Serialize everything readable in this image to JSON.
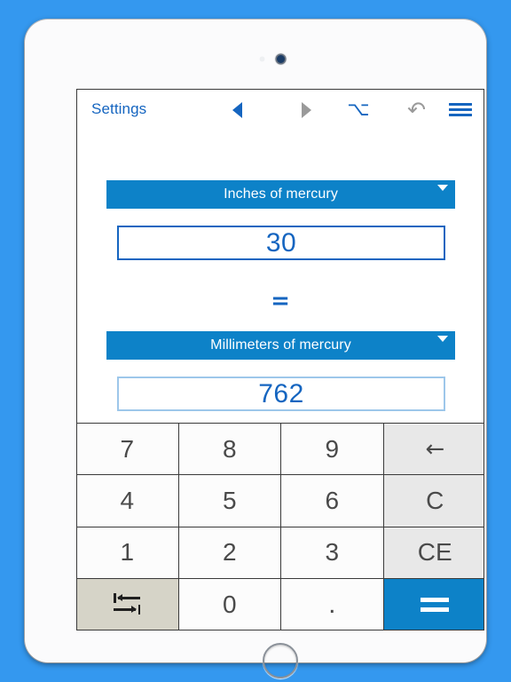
{
  "device": {
    "camera_icon": "camera-lens",
    "sensor_icon": "ambient-light-sensor",
    "home_button_label": "Home"
  },
  "toolbar": {
    "settings_label": "Settings",
    "back_icon": "triangle-left-icon",
    "forward_icon": "triangle-right-icon",
    "option_icon": "option-key-icon",
    "option_glyph": "⌥",
    "undo_icon": "undo-arrow-icon",
    "undo_glyph": "↷",
    "menu_icon": "hamburger-menu-icon",
    "back_color": "#1565c0",
    "forward_color": "#9a9a9a",
    "undo_color": "#9a9a9a",
    "menu_color": "#1565c0"
  },
  "converter": {
    "accent_color": "#0d82c8",
    "text_color": "#1565c0",
    "source": {
      "unit_label": "Inches of mercury",
      "value": "30",
      "caret_icon": "chevron-down-icon",
      "focused": true
    },
    "equals_separator": "=",
    "target": {
      "unit_label": "Millimeters of mercury",
      "value": "762",
      "caret_icon": "chevron-down-icon",
      "focused": false
    }
  },
  "keypad": {
    "keys": [
      {
        "label": "7",
        "name": "key-7",
        "type": "digit"
      },
      {
        "label": "8",
        "name": "key-8",
        "type": "digit"
      },
      {
        "label": "9",
        "name": "key-9",
        "type": "digit"
      },
      {
        "label": "←",
        "name": "key-backspace",
        "type": "func"
      },
      {
        "label": "4",
        "name": "key-4",
        "type": "digit"
      },
      {
        "label": "5",
        "name": "key-5",
        "type": "digit"
      },
      {
        "label": "6",
        "name": "key-6",
        "type": "digit"
      },
      {
        "label": "C",
        "name": "key-clear",
        "type": "func"
      },
      {
        "label": "1",
        "name": "key-1",
        "type": "digit"
      },
      {
        "label": "2",
        "name": "key-2",
        "type": "digit"
      },
      {
        "label": "3",
        "name": "key-3",
        "type": "digit"
      },
      {
        "label": "CE",
        "name": "key-clear-entry",
        "type": "func"
      },
      {
        "label": "",
        "name": "key-swap-units",
        "type": "swap"
      },
      {
        "label": "0",
        "name": "key-0",
        "type": "digit"
      },
      {
        "label": ".",
        "name": "key-decimal",
        "type": "dot"
      },
      {
        "label": "=",
        "name": "key-equals",
        "type": "eq"
      }
    ],
    "swap_icon": "swap-units-icon",
    "equals_icon": "equals-icon",
    "func_bg": "#e8e8e8",
    "swap_bg": "#d6d4c8",
    "equals_bg": "#0d82c8"
  }
}
